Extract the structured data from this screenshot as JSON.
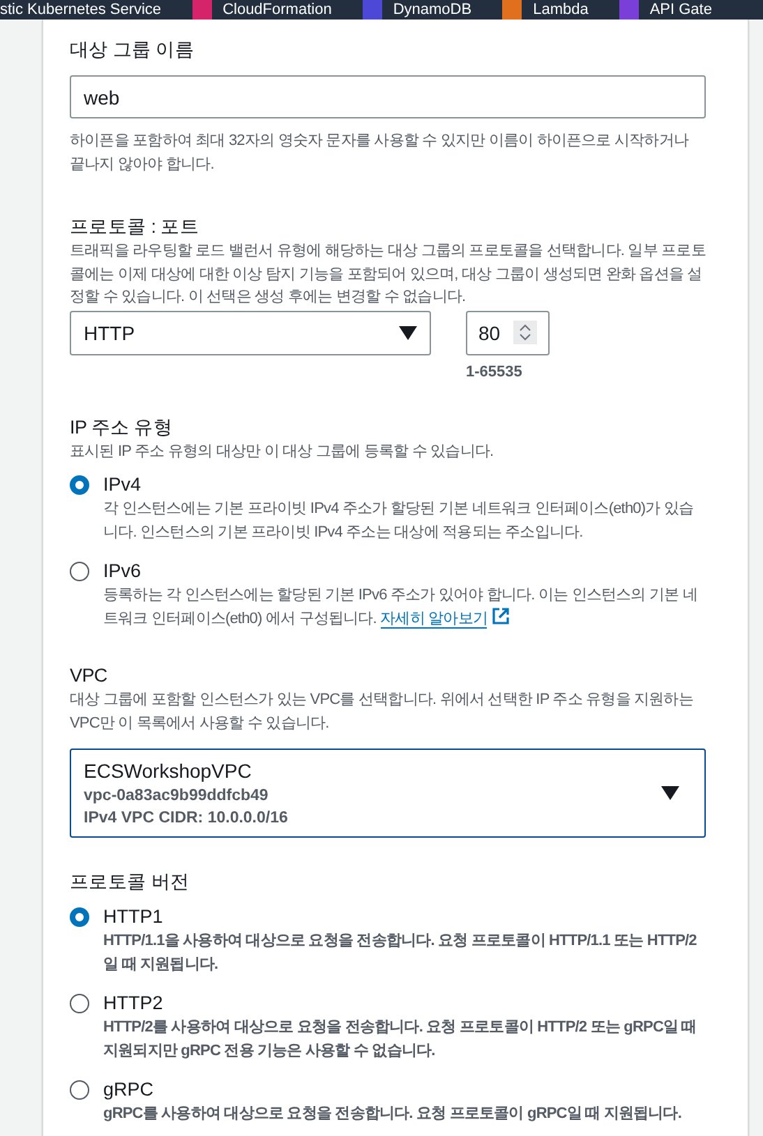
{
  "top_nav": {
    "services": [
      {
        "label": "stic Kubernetes Service"
      },
      {
        "label": "CloudFormation",
        "color": "#d6246b"
      },
      {
        "label": "DynamoDB",
        "color": "#4d48d6"
      },
      {
        "label": "Lambda",
        "color": "#e0701e"
      },
      {
        "label": "API Gate",
        "color": "#7b3fd9"
      }
    ]
  },
  "target_group_name": {
    "label": "대상 그룹 이름",
    "value": "web",
    "hint": "하이픈을 포함하여 최대 32자의 영숫자 문자를 사용할 수 있지만 이름이 하이픈으로 시작하거나 끝나지 않아야 합니다."
  },
  "protocol_port": {
    "label": "프로토콜 : 포트",
    "description": "트래픽을 라우팅할 로드 밸런서 유형에 해당하는 대상 그룹의 프로토콜을 선택합니다. 일부 프로토콜에는 이제 대상에 대한 이상 탐지 기능을 포함되어 있으며, 대상 그룹이 생성되면 완화 옵션을 설정할 수 있습니다. 이 선택은 생성 후에는 변경할 수 없습니다.",
    "protocol": "HTTP",
    "port": "80",
    "port_range": "1-65535"
  },
  "ip_address_type": {
    "label": "IP 주소 유형",
    "description": "표시된 IP 주소 유형의 대상만 이 대상 그룹에 등록할 수 있습니다.",
    "options": [
      {
        "label": "IPv4",
        "selected": true,
        "description": "각 인스턴스에는 기본 프라이빗 IPv4 주소가 할당된 기본 네트워크 인터페이스(eth0)가 있습니다. 인스턴스의 기본 프라이빗 IPv4 주소는 대상에 적용되는 주소입니다."
      },
      {
        "label": "IPv6",
        "selected": false,
        "description": "등록하는 각 인스턴스에는 할당된 기본 IPv6 주소가 있어야 합니다. 이는 인스턴스의 기본 네트워크 인터페이스(eth0) 에서 구성됩니다.",
        "link": "자세히 알아보기"
      }
    ]
  },
  "vpc": {
    "label": "VPC",
    "description": "대상 그룹에 포함할 인스턴스가 있는 VPC를 선택합니다. 위에서 선택한 IP 주소 유형을 지원하는 VPC만 이 목록에서 사용할 수 있습니다.",
    "name": "ECSWorkshopVPC",
    "id": "vpc-0a83ac9b99ddfcb49",
    "cidr": "IPv4 VPC CIDR: 10.0.0.0/16"
  },
  "protocol_version": {
    "label": "프로토콜 버전",
    "options": [
      {
        "label": "HTTP1",
        "selected": true,
        "description": "HTTP/1.1을 사용하여 대상으로 요청을 전송합니다. 요청 프로토콜이 HTTP/1.1 또는 HTTP/2일 때 지원됩니다."
      },
      {
        "label": "HTTP2",
        "selected": false,
        "description": "HTTP/2를 사용하여 대상으로 요청을 전송합니다. 요청 프로토콜이 HTTP/2 또는 gRPC일 때 지원되지만 gRPC 전용 기능은 사용할 수 없습니다."
      },
      {
        "label": "gRPC",
        "selected": false,
        "description": "gRPC를 사용하여 대상으로 요청을 전송합니다. 요청 프로토콜이 gRPC일 때 지원됩니다."
      }
    ]
  }
}
